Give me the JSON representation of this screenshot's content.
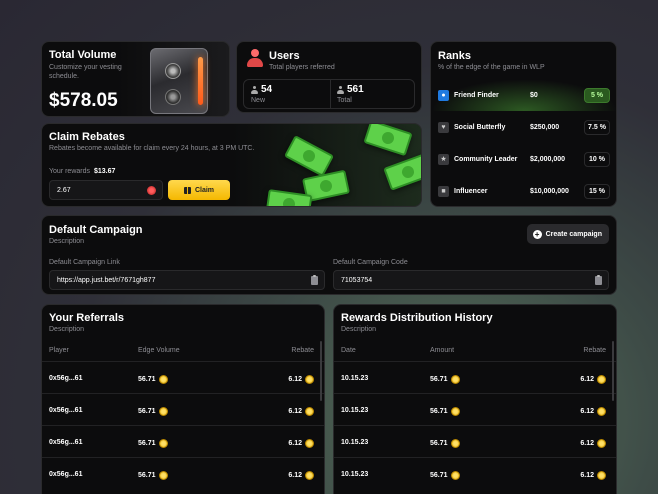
{
  "total_volume": {
    "title": "Total Volume",
    "subtitle": "Customize your vesting schedule.",
    "amount": "$578.05"
  },
  "users": {
    "title": "Users",
    "subtitle": "Total players referred",
    "new_count": "54",
    "new_label": "New",
    "total_count": "561",
    "total_label": "Total"
  },
  "claim": {
    "title": "Claim Rebates",
    "subtitle": "Rebates become available for claim every 24 hours, at 3 PM UTC.",
    "rewards_label": "Your rewards",
    "rewards_value": "$13.67",
    "input_value": "2.67",
    "button_label": "Claim"
  },
  "ranks": {
    "title": "Ranks",
    "subtitle": "% of the edge of the game in WLP",
    "items": [
      {
        "name": "Friend Finder",
        "prize": "$0",
        "pct": "5 %",
        "icon": "person-badge-icon",
        "active": true
      },
      {
        "name": "Social Butterfly",
        "prize": "$250,000",
        "pct": "7.5 %",
        "icon": "heart-icon",
        "active": false
      },
      {
        "name": "Community Leader",
        "prize": "$2,000,000",
        "pct": "10 %",
        "icon": "star-icon",
        "active": false
      },
      {
        "name": "Influencer",
        "prize": "$10,000,000",
        "pct": "15 %",
        "icon": "megaphone-icon",
        "active": false
      }
    ]
  },
  "campaign": {
    "title": "Default Campaign",
    "subtitle": "Description",
    "create_label": "Create campaign",
    "link_label": "Default Campaign Link",
    "link_value": "https://app.just.bet/r/7671gh877",
    "code_label": "Default Campaign Code",
    "code_value": "71053754"
  },
  "referrals": {
    "title": "Your Referrals",
    "subtitle": "Description",
    "columns": [
      "Player",
      "Edge Volume",
      "Rebate"
    ],
    "rows": [
      [
        "0x56g...61",
        "56.71",
        "6.12"
      ],
      [
        "0x56g...61",
        "56.71",
        "6.12"
      ],
      [
        "0x56g...61",
        "56.71",
        "6.12"
      ],
      [
        "0x56g...61",
        "56.71",
        "6.12"
      ]
    ]
  },
  "history": {
    "title": "Rewards Distribution History",
    "subtitle": "Description",
    "columns": [
      "Date",
      "Amount",
      "Rebate"
    ],
    "rows": [
      [
        "10.15.23",
        "56.71",
        "6.12"
      ],
      [
        "10.15.23",
        "56.71",
        "6.12"
      ],
      [
        "10.15.23",
        "56.71",
        "6.12"
      ],
      [
        "10.15.23",
        "56.71",
        "6.12"
      ]
    ]
  },
  "colors": {
    "accent_yellow": "#f5b800",
    "active_green": "#2a5a1f",
    "card_bg": "#0c0c0d"
  }
}
